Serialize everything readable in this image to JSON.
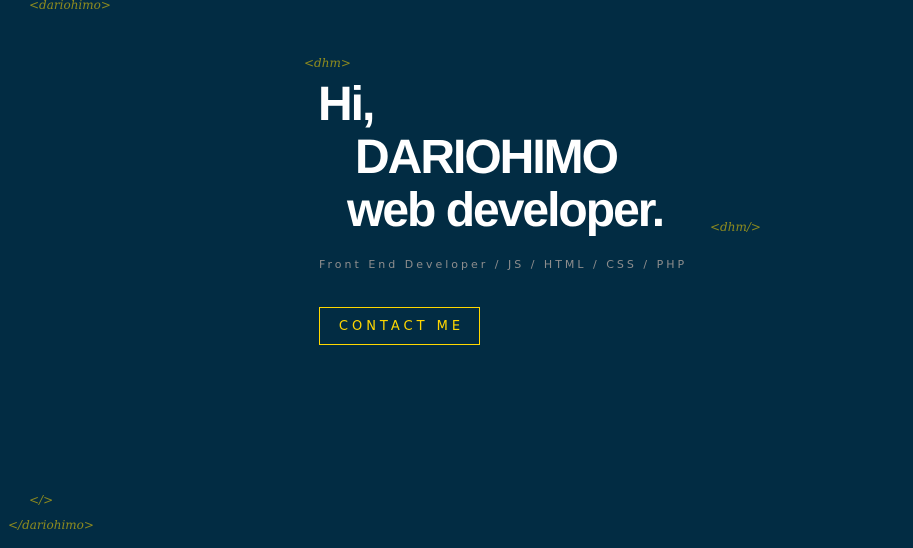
{
  "tags": {
    "top": "<dariohimo>",
    "heading_open": "<dhm>",
    "heading_close": "<dhm/>",
    "self_close": "</>",
    "bottom": "</dariohimo>"
  },
  "hero": {
    "line1": "Hi,",
    "line2": "DARIOHIMO",
    "line3": "web developer.",
    "subtitle": "Front End Developer / JS / HTML / CSS / PHP",
    "contact_label": "CONTACT ME"
  },
  "colors": {
    "background": "#022c43",
    "accent": "#ffd700",
    "heading": "#ffffff",
    "subtitle": "#8d8d8d"
  }
}
